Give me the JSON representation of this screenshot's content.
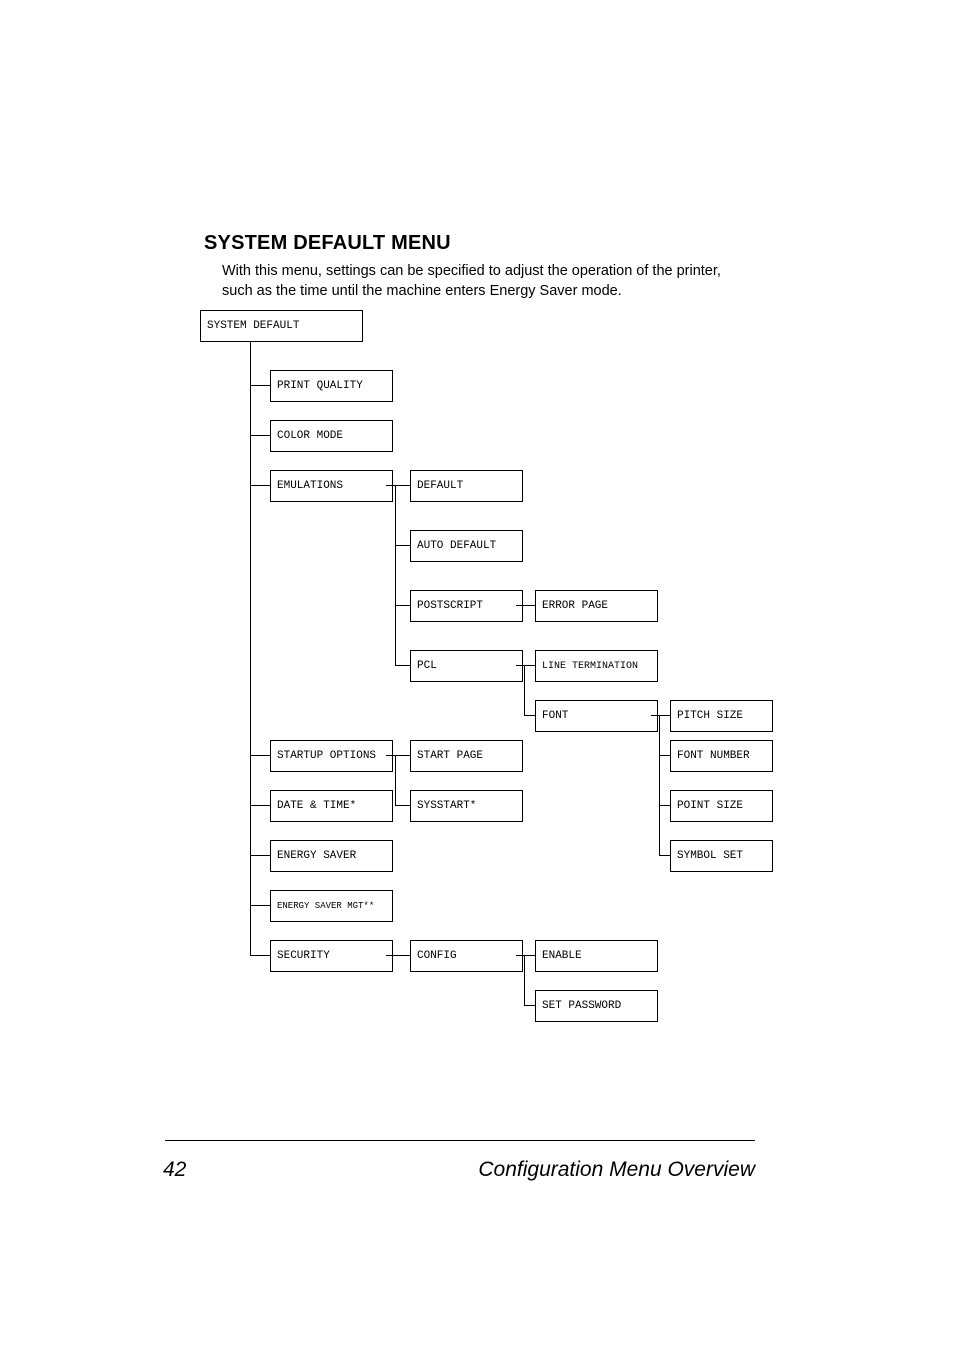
{
  "heading": "SYSTEM DEFAULT MENU",
  "intro": "With this menu, settings can be specified to adjust the operation of the printer, such as the time until the machine enters Energy Saver mode.",
  "boxes": {
    "system_default": "SYSTEM DEFAULT",
    "print_quality": "PRINT QUALITY",
    "color_mode": "COLOR MODE",
    "emulations": "EMULATIONS",
    "default": "DEFAULT",
    "auto_default": "AUTO DEFAULT",
    "postscript": "POSTSCRIPT",
    "error_page": "ERROR PAGE",
    "pcl": "PCL",
    "line_termination": "LINE TERMINATION",
    "font": "FONT",
    "pitch_size": "PITCH SIZE",
    "startup_options": "STARTUP OPTIONS",
    "start_page": "START PAGE",
    "font_number": "FONT NUMBER",
    "date_time": "DATE & TIME*",
    "sysstart": "SYSSTART*",
    "point_size": "POINT SIZE",
    "energy_saver": "ENERGY SAVER",
    "symbol_set": "SYMBOL SET",
    "energy_saver_mgt": "ENERGY SAVER MGT**",
    "security": "SECURITY",
    "config": "CONFIG",
    "enable": "ENABLE",
    "set_password": "SET PASSWORD"
  },
  "footer": {
    "page_number": "42",
    "title": "Configuration Menu Overview"
  }
}
